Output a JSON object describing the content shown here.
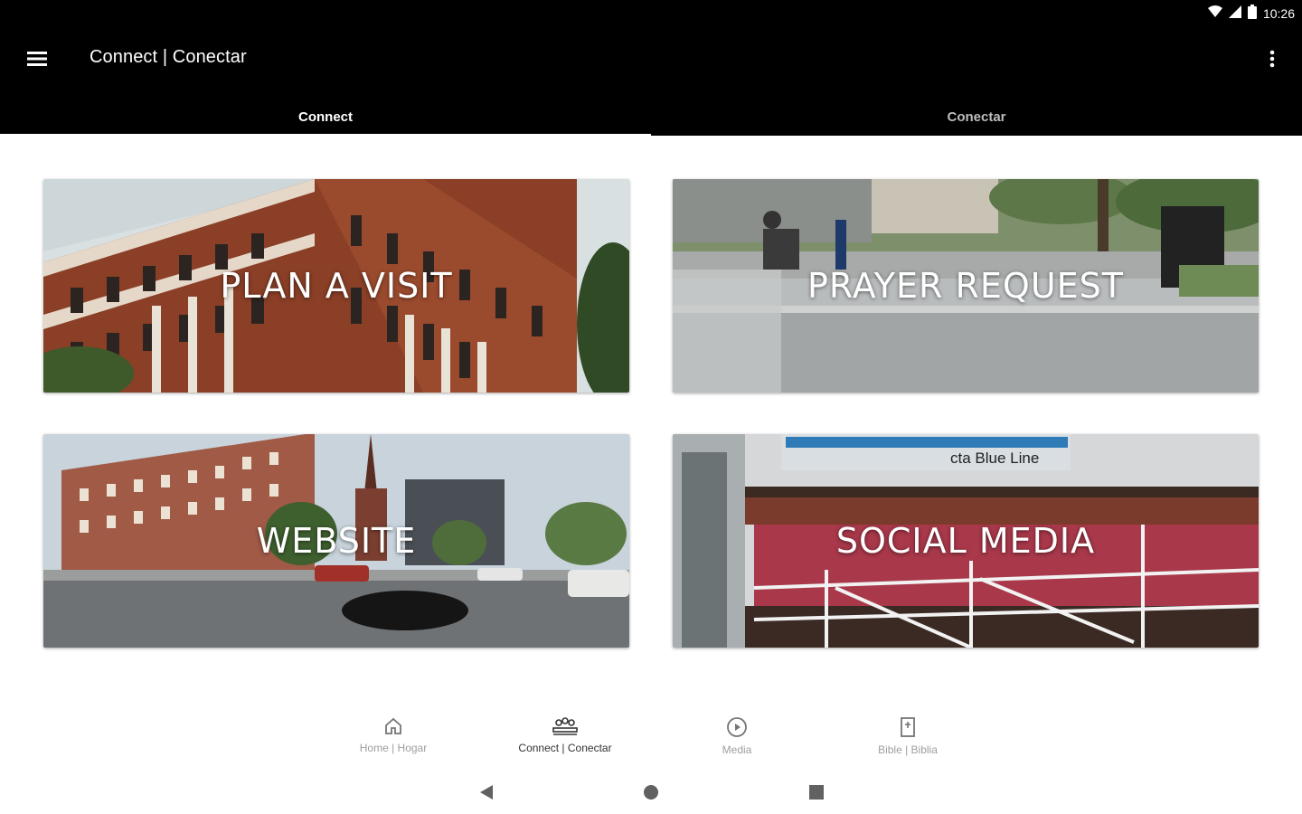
{
  "status_bar": {
    "time": "10:26"
  },
  "app_bar": {
    "title": "Connect | Conectar"
  },
  "tabs": [
    {
      "label": "Connect",
      "selected": true
    },
    {
      "label": "Conectar",
      "selected": false
    }
  ],
  "cards": [
    {
      "label": "PLAN A VISIT"
    },
    {
      "label": "PRAYER REQUEST"
    },
    {
      "label": "WEBSITE"
    },
    {
      "label": "SOCIAL MEDIA"
    }
  ],
  "bottom_nav": [
    {
      "label": "Home | Hogar",
      "icon": "home-icon",
      "active": false
    },
    {
      "label": "Connect | Conectar",
      "icon": "people-icon",
      "active": true
    },
    {
      "label": "Media",
      "icon": "play-circle-icon",
      "active": false
    },
    {
      "label": "Bible | Biblia",
      "icon": "book-icon",
      "active": false
    }
  ],
  "photo_text": {
    "station_sign": "cta Blue Line"
  },
  "colors": {
    "app_bar": "#000000",
    "tab_selected": "#ffffff",
    "tab_unselected": "#bdbdbd",
    "nav_inactive": "#9e9e9e"
  }
}
